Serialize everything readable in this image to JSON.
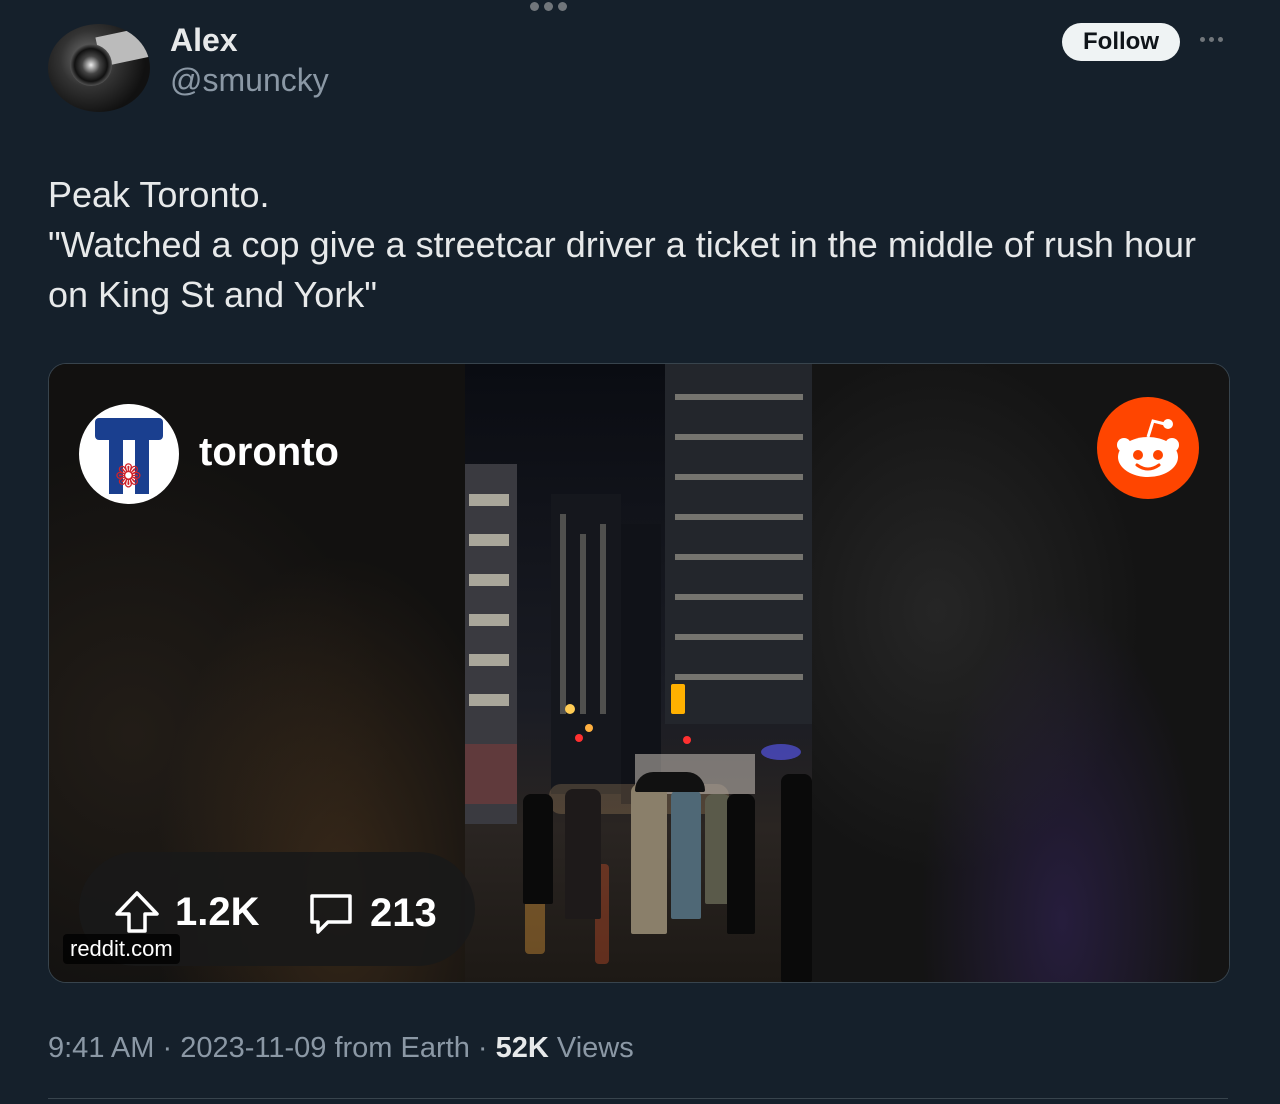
{
  "author": {
    "name": "Alex",
    "handle": "@smuncky",
    "follow_label": "Follow"
  },
  "tweet": {
    "lines": [
      "Peak Toronto.",
      "\"Watched a cop give a streetcar driver a ticket in the middle of rush hour",
      "on King St and York\""
    ]
  },
  "card": {
    "subreddit": "toronto",
    "upvotes": "1.2K",
    "comments": "213",
    "domain": "reddit.com",
    "icons": [
      "toronto-subreddit-logo-icon",
      "reddit-alien-logo-icon",
      "upvote-arrow-icon",
      "comment-bubble-icon"
    ]
  },
  "meta": {
    "time": "9:41 AM",
    "sep1": "·",
    "date": "2023-11-09",
    "from": "from Earth",
    "sep2": "·",
    "views_count": "52K",
    "views_label": "Views"
  },
  "colors": {
    "background": "#15202b",
    "reddit_orange": "#ff4500",
    "muted_text": "#8b98a5"
  }
}
